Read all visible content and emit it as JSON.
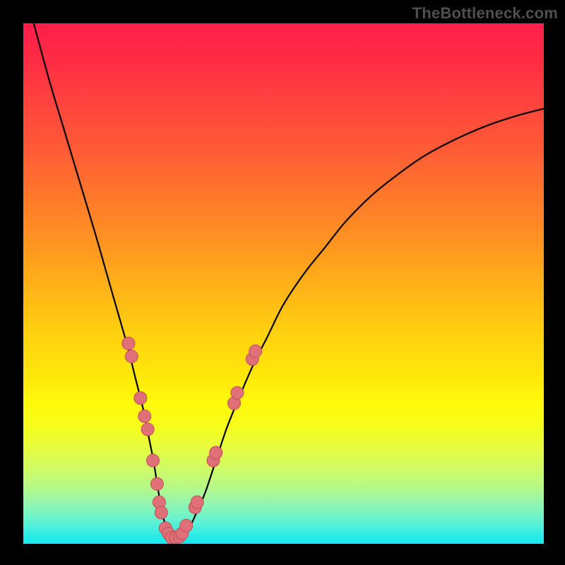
{
  "watermark": "TheBottleneck.com",
  "chart_data": {
    "type": "line",
    "title": "",
    "xlabel": "",
    "ylabel": "",
    "xlim": [
      0,
      100
    ],
    "ylim": [
      0,
      100
    ],
    "grid": false,
    "series": [
      {
        "name": "curve",
        "color": "#000000",
        "x": [
          2,
          5,
          8,
          11,
          14,
          16,
          18,
          20,
          21.5,
          23,
          24,
          25,
          25.8,
          26.5,
          27.3,
          28.2,
          29,
          30,
          31,
          32,
          33.5,
          35,
          37,
          39,
          41,
          44,
          47,
          50,
          54,
          58,
          62,
          67,
          72,
          77,
          83,
          89,
          95,
          100
        ],
        "y": [
          100,
          89,
          79,
          69,
          59,
          52,
          45,
          38,
          32,
          26,
          21,
          16,
          11,
          7,
          3.5,
          1.5,
          0.7,
          0.7,
          1.5,
          3.2,
          6.5,
          10,
          16,
          22,
          27,
          34,
          40,
          46,
          52,
          57,
          62,
          67,
          71,
          74.5,
          77.7,
          80.3,
          82.3,
          83.6
        ]
      }
    ],
    "markers": [
      {
        "x": 20.2,
        "y": 38.5
      },
      {
        "x": 20.8,
        "y": 36
      },
      {
        "x": 22.5,
        "y": 28
      },
      {
        "x": 23.3,
        "y": 24.5
      },
      {
        "x": 23.9,
        "y": 22
      },
      {
        "x": 24.9,
        "y": 16
      },
      {
        "x": 25.7,
        "y": 11.5
      },
      {
        "x": 26.1,
        "y": 8
      },
      {
        "x": 26.5,
        "y": 6
      },
      {
        "x": 27.3,
        "y": 3
      },
      {
        "x": 27.9,
        "y": 2
      },
      {
        "x": 28.5,
        "y": 1.2
      },
      {
        "x": 29.3,
        "y": 1.2
      },
      {
        "x": 30.0,
        "y": 1.4
      },
      {
        "x": 30.5,
        "y": 2
      },
      {
        "x": 31.3,
        "y": 3.5
      },
      {
        "x": 33.0,
        "y": 7
      },
      {
        "x": 33.4,
        "y": 8
      },
      {
        "x": 36.5,
        "y": 16
      },
      {
        "x": 37.0,
        "y": 17.5
      },
      {
        "x": 40.5,
        "y": 27
      },
      {
        "x": 41.1,
        "y": 29
      },
      {
        "x": 44.0,
        "y": 35.5
      },
      {
        "x": 44.6,
        "y": 37
      }
    ],
    "marker_style": {
      "fill": "#e07077",
      "stroke": "#c05058",
      "radius_px": 9
    },
    "background_gradient": {
      "top": "#ff1f4a",
      "bottom": "#14eae8"
    }
  }
}
